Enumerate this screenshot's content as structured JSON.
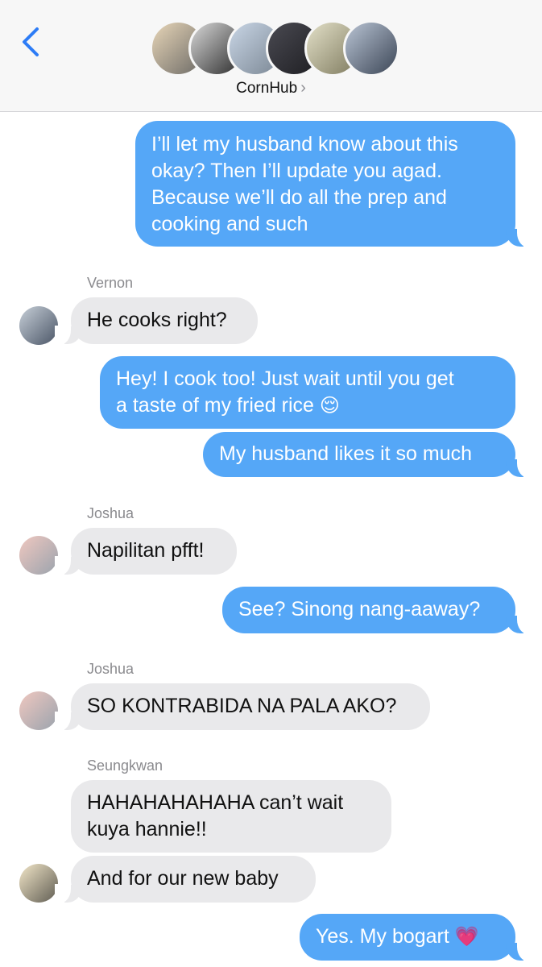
{
  "header": {
    "group_name": "CornHub",
    "chevron": "›",
    "back_icon": "chevron-left-icon",
    "accent": "#2d7cf6"
  },
  "colors": {
    "outgoing_bubble": "#55a7f7",
    "incoming_bubble": "#e9e9eb",
    "sender_label": "#8a8a8e"
  },
  "messages": [
    {
      "direction": "out",
      "lines": [
        "I’ll let my husband know about this",
        "okay? Then I’ll update you agad.",
        "Because we’ll do all the prep and",
        "cooking and such"
      ]
    },
    {
      "direction": "in",
      "sender": "Vernon",
      "lines": [
        "He cooks right?"
      ]
    },
    {
      "direction": "out",
      "lines": [
        "Hey! I cook too! Just wait until you get",
        "a taste of my fried rice"
      ],
      "emoji": "😌"
    },
    {
      "direction": "out",
      "lines": [
        "My husband likes it so much"
      ]
    },
    {
      "direction": "in",
      "sender": "Joshua",
      "lines": [
        "Napilitan pfft!"
      ]
    },
    {
      "direction": "out",
      "lines": [
        "See? Sinong nang-aaway?"
      ]
    },
    {
      "direction": "in",
      "sender": "Joshua",
      "lines": [
        "SO KONTRABIDA NA PALA AKO?"
      ]
    },
    {
      "direction": "in",
      "sender": "Seungkwan",
      "lines": [
        "HAHAHAHAHAHA can’t wait",
        "kuya hannie!!"
      ]
    },
    {
      "direction": "in",
      "lines": [
        "And for our new baby"
      ]
    },
    {
      "direction": "out",
      "lines": [
        "Yes. My bogart"
      ],
      "emoji": "💗"
    }
  ]
}
